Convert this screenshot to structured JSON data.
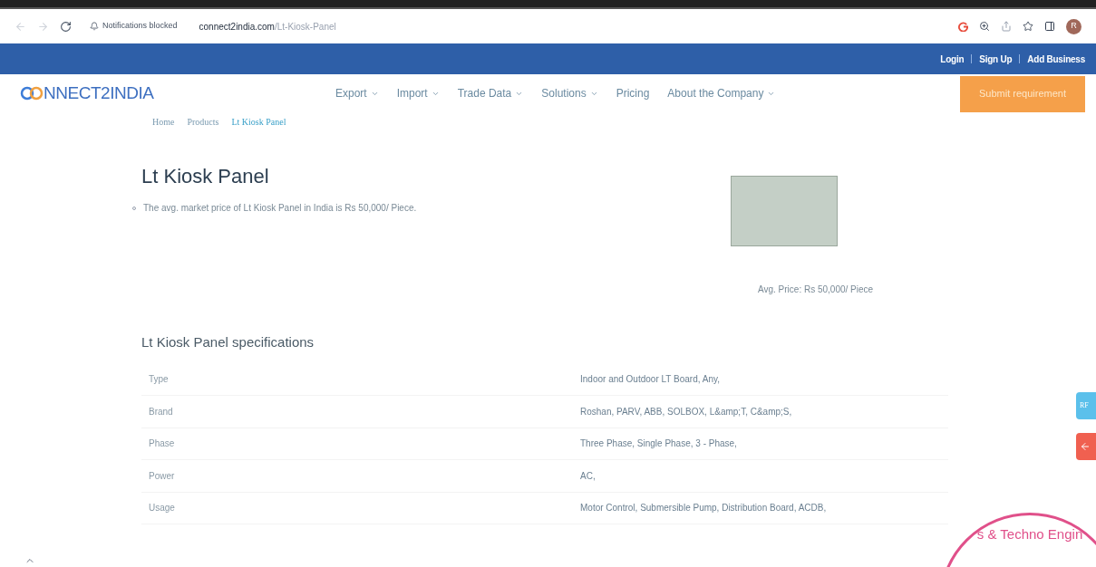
{
  "browser": {
    "notice": "Notifications blocked",
    "url_domain": "connect2india.com",
    "url_path": "/Lt-Kiosk-Panel",
    "profile_initial": "R"
  },
  "top_bar": {
    "links": [
      "Login",
      "Sign Up",
      "Add Business"
    ]
  },
  "nav": {
    "logo": "NNECT2INDIA",
    "items": [
      {
        "label": "Export",
        "dropdown": true
      },
      {
        "label": "Import",
        "dropdown": true
      },
      {
        "label": "Trade Data",
        "dropdown": true
      },
      {
        "label": "Solutions",
        "dropdown": true
      },
      {
        "label": "Pricing",
        "dropdown": false
      },
      {
        "label": "About the Company",
        "dropdown": true
      }
    ],
    "cta": "Submit requirement"
  },
  "breadcrumb": [
    {
      "label": "Home",
      "selected": false
    },
    {
      "label": "Products",
      "selected": false
    },
    {
      "label": "Lt Kiosk Panel",
      "selected": true
    }
  ],
  "product": {
    "title": "Lt Kiosk Panel",
    "bullets": [
      "The avg. market price of Lt Kiosk Panel in India is Rs 50,000/ Piece."
    ],
    "avg_price": "Avg. Price: Rs 50,000/ Piece"
  },
  "specifications": {
    "heading": "Lt Kiosk Panel specifications",
    "rows": [
      {
        "label": "Type",
        "value": "Indoor and Outdoor LT Board, Any,"
      },
      {
        "label": "Brand",
        "value": "Roshan, PARV, ABB, SOLBOX, L&amp;T, C&amp;S,"
      },
      {
        "label": "Phase",
        "value": "Three Phase, Single Phase, 3 - Phase,"
      },
      {
        "label": "Power",
        "value": "AC,"
      },
      {
        "label": "Usage",
        "value": "Motor Control, Submersible Pump, Distribution Board, ACDB,"
      }
    ]
  },
  "side_tabs": {
    "rfq": "RF"
  },
  "stamp": {
    "text": "s & Techno Engin"
  }
}
